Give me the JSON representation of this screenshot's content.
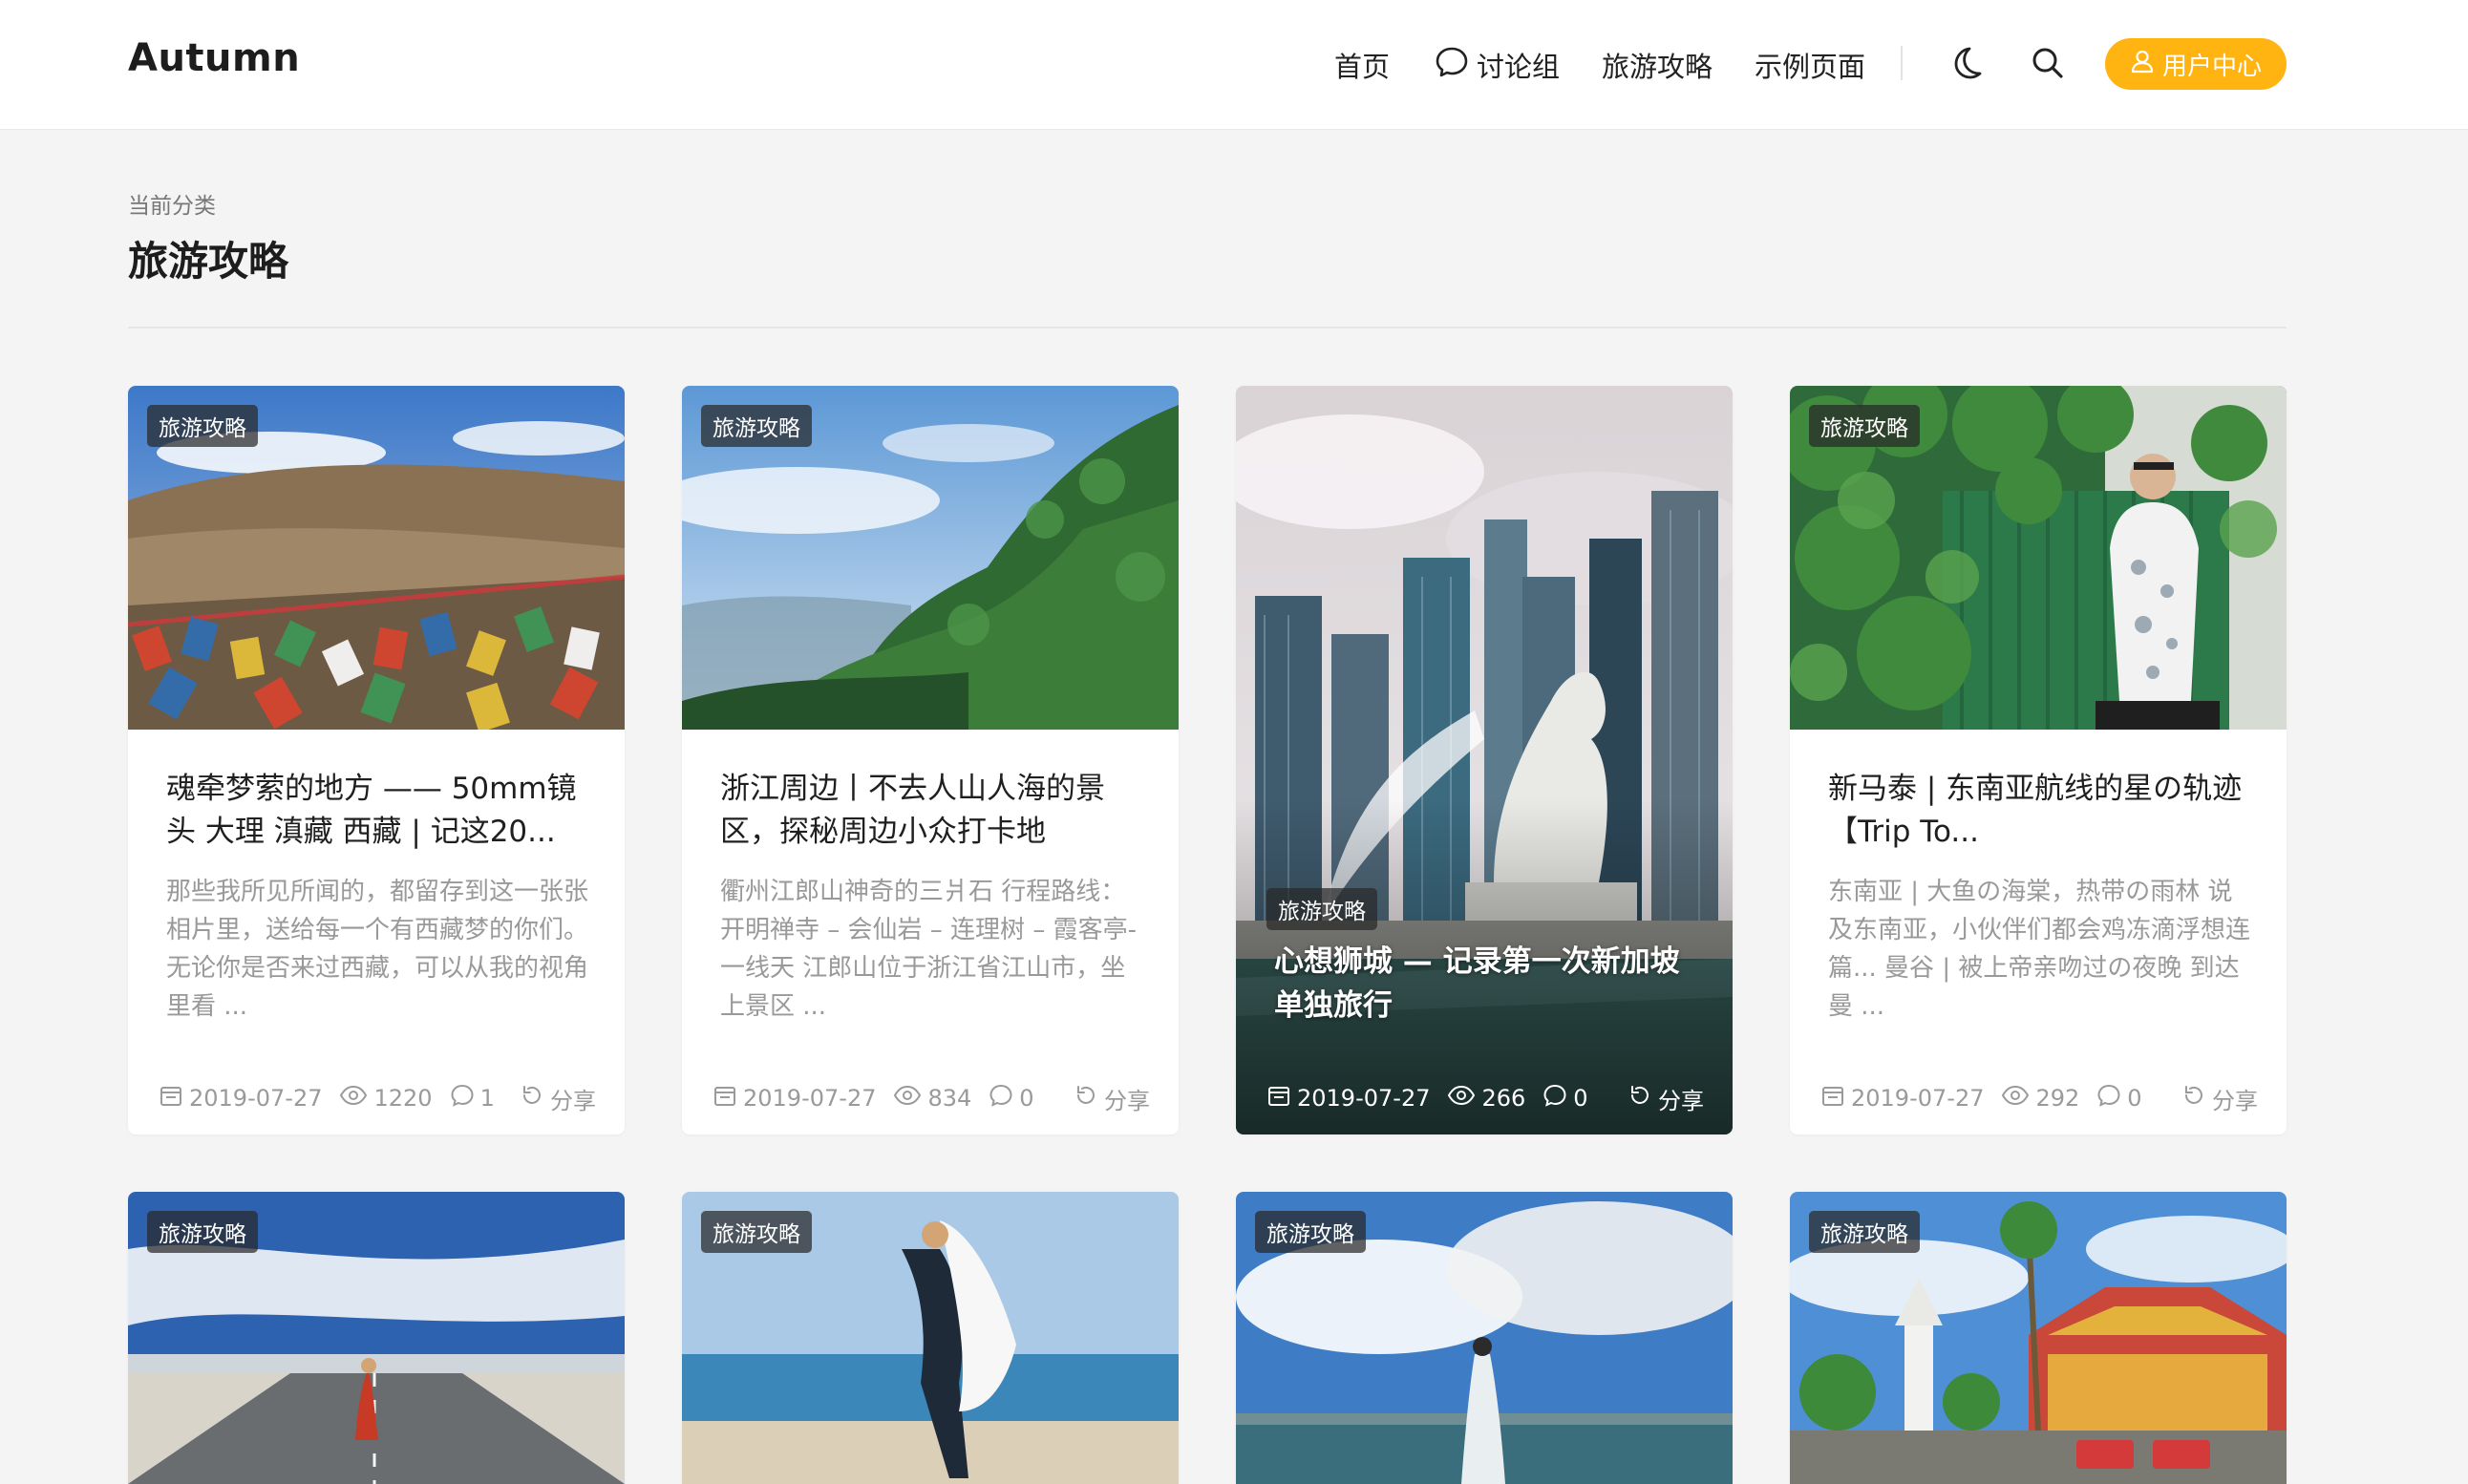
{
  "header": {
    "brand": "Autumn",
    "nav": [
      {
        "label": "首页"
      },
      {
        "label": "讨论组"
      },
      {
        "label": "旅游攻略"
      },
      {
        "label": "示例页面"
      }
    ],
    "user_center_label": "用户中心",
    "accent_color": "#ffb412",
    "icons": [
      "moon-icon",
      "search-icon",
      "user-icon",
      "chat-bubble-icon"
    ]
  },
  "category": {
    "label": "当前分类",
    "title": "旅游攻略"
  },
  "cards": [
    {
      "tag": "旅游攻略",
      "title": "魂牵梦萦的地方 —— 50mm镜头 大理 滇藏 西藏 | 记这20...",
      "excerpt": "那些我所见所闻的，都留存到这一张张相片里，送给每一个有西藏梦的你们。无论你是否来过西藏，可以从我的视角里看 ...",
      "date": "2019-07-27",
      "views": "1220",
      "comments": "1",
      "share": "分享"
    },
    {
      "tag": "旅游攻略",
      "title": "浙江周边丨不去人山人海的景区，探秘周边小众打卡地",
      "excerpt": "衢州江郎山神奇的三爿石 行程路线：开明禅寺 – 会仙岩 – 连理树 – 霞客亭- 一线天 江郎山位于浙江省江山市，坐上景区 ...",
      "date": "2019-07-27",
      "views": "834",
      "comments": "0",
      "share": "分享"
    },
    {
      "tag": "旅游攻略",
      "title": "心想狮城 — 记录第一次新加坡单独旅行",
      "date": "2019-07-27",
      "views": "266",
      "comments": "0",
      "share": "分享"
    },
    {
      "tag": "旅游攻略",
      "title": "新马泰 | 东南亚航线的星の轨迹 【Trip To...",
      "excerpt": "东南亚 | 大鱼の海棠，热带の雨林 说及东南亚，小伙伴们都会鸡冻滴浮想连篇... 曼谷 | 被上帝亲吻过の夜晚 到达曼 ...",
      "date": "2019-07-27",
      "views": "292",
      "comments": "0",
      "share": "分享"
    }
  ],
  "cards_row2": [
    {
      "tag": "旅游攻略"
    },
    {
      "tag": "旅游攻略"
    },
    {
      "tag": "旅游攻略"
    },
    {
      "tag": "旅游攻略"
    }
  ]
}
